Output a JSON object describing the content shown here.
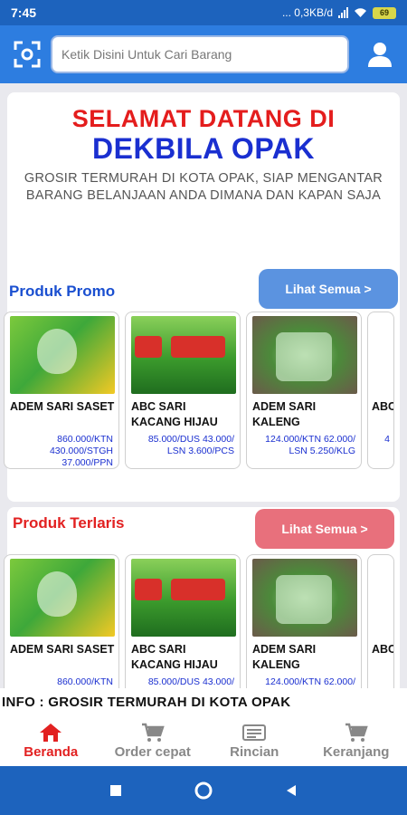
{
  "status_bar": {
    "time": "7:45",
    "indicators": "... 0,3KB/d",
    "battery": "69",
    "color": "#1d63bd"
  },
  "app_bar": {
    "search_placeholder": "Ketik Disini Untuk Cari Barang",
    "scan_icon": "scan-icon",
    "user_icon": "user-icon",
    "color": "#2d7de0"
  },
  "welcome": {
    "line1": "SELAMAT DATANG DI",
    "line2": "DEKBILA OPAK",
    "tagline": "GROSIR TERMURAH DI KOTA OPAK, SIAP MENGANTAR BARANG BELANJAAN ANDA DIMANA DAN KAPAN SAJA",
    "line1_color": "#e41d1d",
    "line2_color": "#1a2fd0"
  },
  "promo": {
    "title": "Produk Promo",
    "see_all": "Lihat Semua >",
    "title_color": "#1a4fd0",
    "button_color": "#5b93e0",
    "products": [
      {
        "name": "ADEM SARI SASET",
        "prices": [
          "860.000/KTN",
          "430.000/STGH",
          "37.000/PPN"
        ]
      },
      {
        "name": "ABC SARI KACANG HIJAU",
        "prices": [
          "85.000/DUS 43.000/",
          "LSN 3.600/PCS"
        ]
      },
      {
        "name": "ADEM SARI KALENG",
        "prices": [
          "124.000/KTN 62.000/",
          "LSN 5.250/KLG"
        ]
      },
      {
        "name": "ABC",
        "prices": [
          "4"
        ]
      }
    ]
  },
  "bestseller": {
    "title": "Produk Terlaris",
    "see_all": "Lihat Semua >",
    "title_color": "#e22121",
    "button_color": "#e8707c",
    "products": [
      {
        "name": "ADEM SARI SASET",
        "prices": [
          "860.000/KTN"
        ]
      },
      {
        "name": "ABC SARI KACANG HIJAU",
        "prices": [
          "85.000/DUS 43.000/"
        ]
      },
      {
        "name": "ADEM SARI KALENG",
        "prices": [
          "124.000/KTN 62.000/"
        ]
      },
      {
        "name": "ABC",
        "prices": [
          ""
        ]
      }
    ]
  },
  "info": {
    "text": "INFO : GROSIR  TERMURAH DI KOTA OPAK"
  },
  "bottom_nav": {
    "items": [
      {
        "label": "Beranda",
        "icon": "home-icon",
        "active": true
      },
      {
        "label": "Order cepat",
        "icon": "cart-icon",
        "active": false
      },
      {
        "label": "Rincian",
        "icon": "receipt-icon",
        "active": false
      },
      {
        "label": "Keranjang",
        "icon": "basket-icon",
        "active": false
      }
    ]
  }
}
